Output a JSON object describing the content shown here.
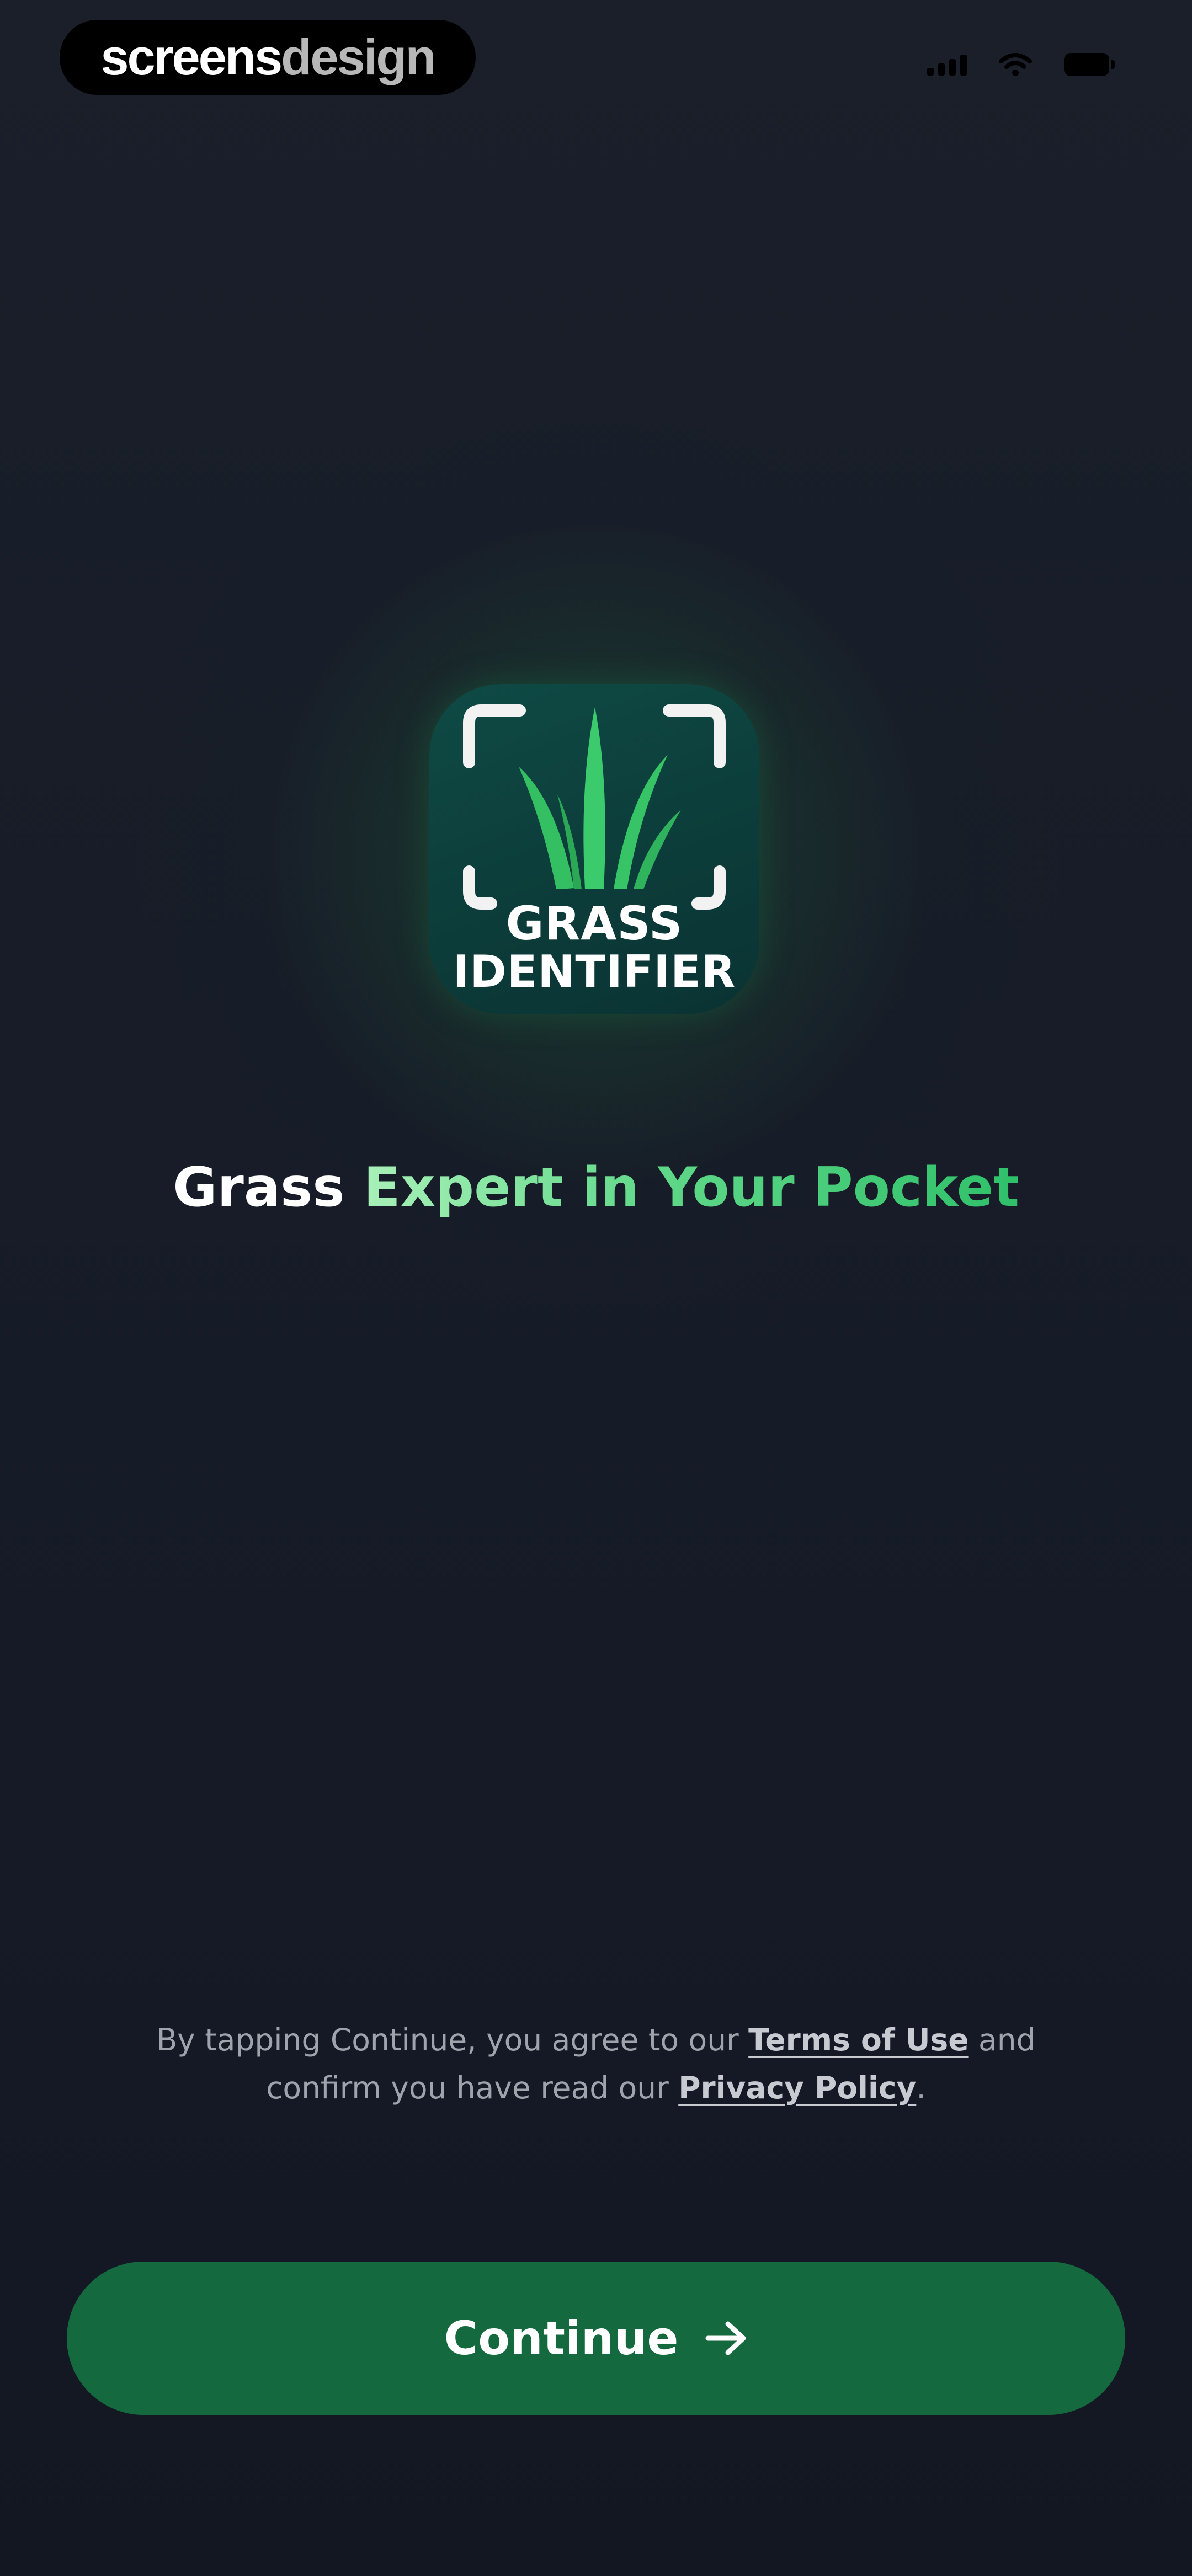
{
  "watermark": {
    "part1": "screens",
    "part2": "design"
  },
  "status_bar": {
    "icons": [
      "signal-icon",
      "wifi-icon",
      "battery-icon"
    ]
  },
  "app_icon": {
    "icon": "grass-scan-icon",
    "line1": "GRASS",
    "line2": "IDENTIFIER",
    "colors": {
      "background": "#0c3d3a",
      "grass": "#3ccb6c",
      "frame": "#f2f2f2"
    }
  },
  "headline": {
    "part1": "Grass",
    "part2": "Expert in Your Pocket",
    "colors": {
      "white": "#ffffff",
      "accent": "#45cf7a"
    }
  },
  "legal": {
    "text1": "By tapping Continue, you agree to our",
    "terms_link": "Terms of Use",
    "text2": "and",
    "text3": "confirm you have read our",
    "privacy_link": "Privacy Policy",
    "text4": "."
  },
  "continue_button": {
    "label": "Continue",
    "icon": "arrow-right-icon",
    "color": "#146a3e"
  }
}
